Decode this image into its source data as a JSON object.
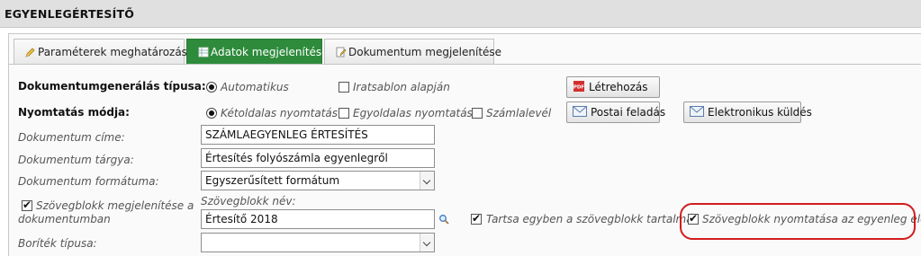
{
  "header": {
    "title": "EGYENLEGÉRTESÍTŐ"
  },
  "tabs": [
    {
      "label": "Paraméterek meghatározása",
      "icon": "pencil-icon"
    },
    {
      "label": "Adatok megjelenítése",
      "icon": "table-icon"
    },
    {
      "label": "Dokumentum megjelenítése",
      "icon": "document-pencil-icon"
    }
  ],
  "colors": {
    "active_tab": "#2e8b3c",
    "highlight": "#d11d1d"
  },
  "form": {
    "doc_type": {
      "label": "Dokumentumgenerálás típusa:",
      "options": [
        {
          "label": "Automatikus",
          "selected": true
        },
        {
          "label": "Iratsablon alapján",
          "selected": false
        }
      ]
    },
    "print_mode": {
      "label": "Nyomtatás módja:",
      "radio": {
        "label": "Kétoldalas nyomtatás",
        "selected": true
      },
      "checks": [
        {
          "label": "Egyoldalas nyomtatás",
          "checked": false
        },
        {
          "label": "Számlalevél",
          "checked": false
        }
      ]
    },
    "doc_title": {
      "label": "Dokumentum címe:",
      "value": "SZÁMLAEGYENLEG ÉRTESÍTÉS"
    },
    "doc_subject": {
      "label": "Dokumentum tárgya:",
      "value": "Értesítés folyószámla egyenlegről"
    },
    "doc_format": {
      "label": "Dokumentum formátuma:",
      "value": "Egyszerűsített formátum"
    },
    "textblock": {
      "show_label_line1": "Szövegblokk megjelenítése a",
      "show_label_line2": "dokumentumban",
      "show_checked": true,
      "name_label": "Szövegblokk név:",
      "name_value": "Értesítő 2018",
      "keep_label": "Tartsa egyben a szövegblokk tartalmát",
      "keep_checked": true,
      "print_before_label": "Szövegblokk nyomtatása az egyenleg elé",
      "print_before_checked": true
    },
    "envelope": {
      "label": "Boríték típusa:",
      "value": ""
    }
  },
  "buttons": {
    "create": "Létrehozás",
    "post": "Postai feladás",
    "electronic": "Elektronikus küldés"
  }
}
